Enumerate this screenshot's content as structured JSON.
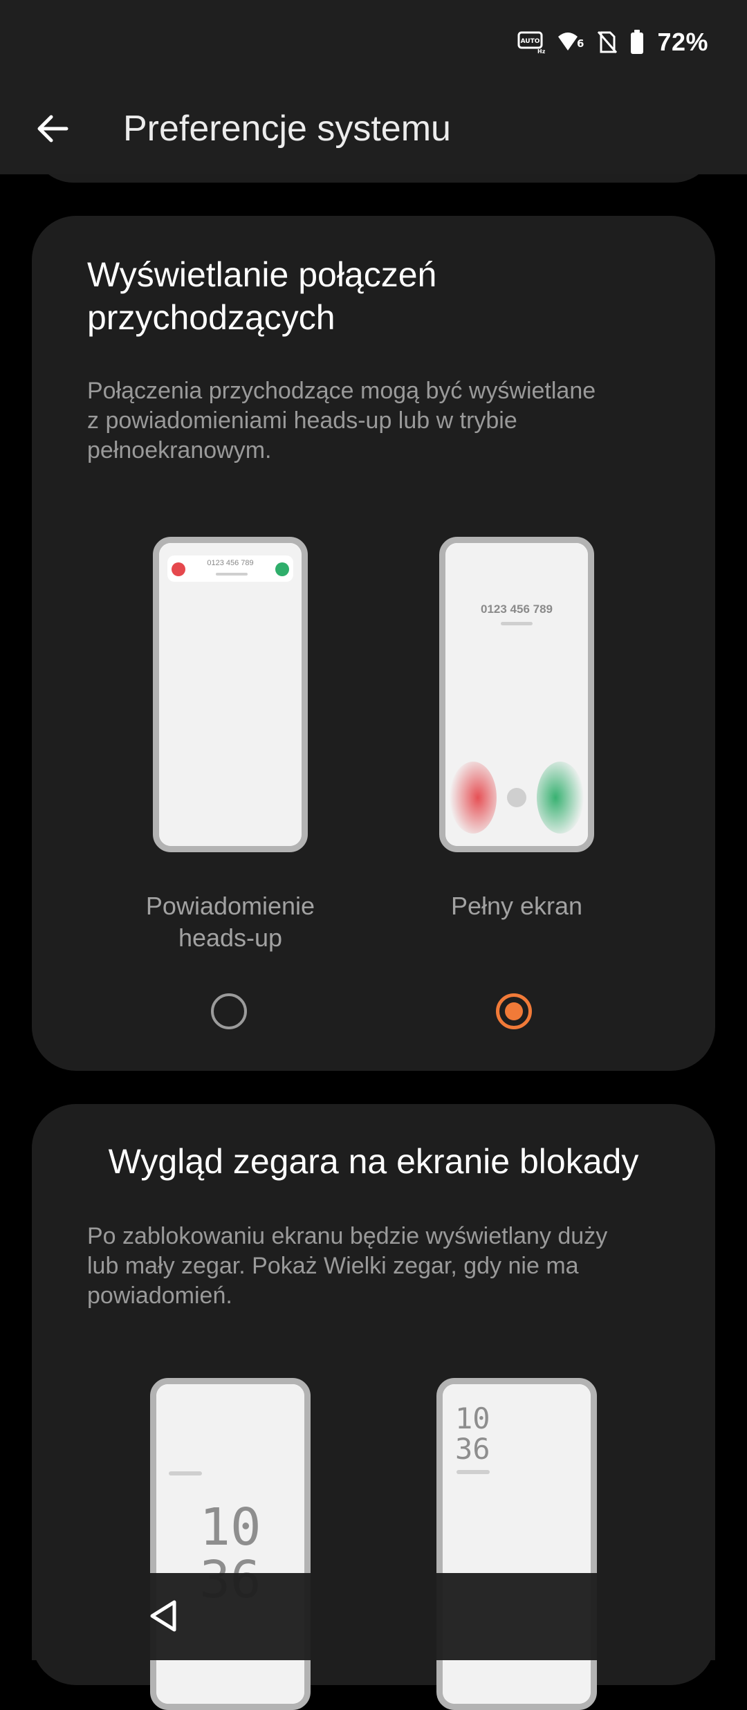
{
  "status_bar": {
    "battery_percent": "72%",
    "icons": [
      "auto-hz-icon",
      "wifi-6-icon",
      "no-sim-icon",
      "battery-icon"
    ]
  },
  "app_bar": {
    "title": "Preferencje systemu",
    "back_icon": "arrow-left-icon"
  },
  "incoming_calls_card": {
    "title_line1": "Wyświetlanie połączeń",
    "title_line2": "przychodzących",
    "description_line1": "Połączenia przychodzące mogą być wyświetlane",
    "description_line2": "z powiadomieniami heads-up lub w trybie",
    "description_line3": "pełnoekranowym.",
    "options": [
      {
        "label_line1": "Powiadomienie",
        "label_line2": "heads-up",
        "selected": false,
        "preview_number": "0123 456 789"
      },
      {
        "label_line1": "Pełny ekran",
        "label_line2": "",
        "selected": true,
        "preview_number": "0123 456 789"
      }
    ]
  },
  "lockscreen_clock_card": {
    "title": "Wygląd zegara na ekranie blokady",
    "description_line1": "Po zablokowaniu ekranu będzie wyświetlany duży",
    "description_line2": "lub mały zegar. Pokaż Wielki zegar, gdy nie ma",
    "description_line3": "powiadomień.",
    "previews": [
      {
        "clock_hours": "10",
        "clock_minutes": "36",
        "size": "large"
      },
      {
        "clock_hours": "10",
        "clock_minutes": "36",
        "size": "small"
      }
    ]
  },
  "colors": {
    "accent": "#f17a38",
    "decline_red": "#e5484d",
    "accept_green": "#2fae6b",
    "background": "#000000",
    "card": "#1e1e1e",
    "bar": "#1f1f1f"
  },
  "nav_bar": {
    "back_icon": "triangle-back-icon"
  }
}
